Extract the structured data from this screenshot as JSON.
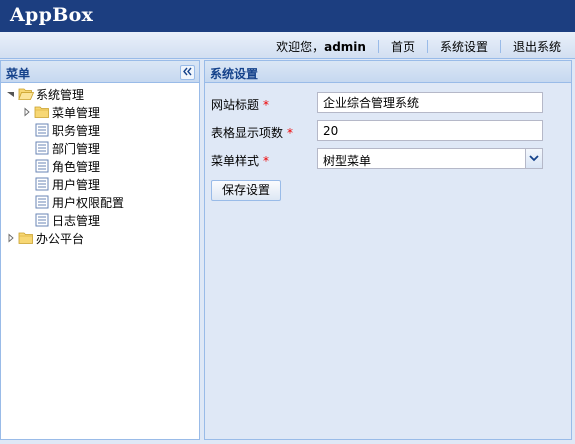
{
  "app": {
    "title": "AppBox"
  },
  "topbar": {
    "welcome": "欢迎您，",
    "username": "admin",
    "links": [
      "首页",
      "系统设置",
      "退出系统"
    ]
  },
  "menu": {
    "title": "菜单",
    "collapse_icon": "double-chevron-left-icon",
    "tree": [
      {
        "label": "系统管理",
        "type": "folder",
        "expanded": true,
        "level": 0
      },
      {
        "label": "菜单管理",
        "type": "folder",
        "expanded": false,
        "level": 1
      },
      {
        "label": "职务管理",
        "type": "leaf",
        "level": 1
      },
      {
        "label": "部门管理",
        "type": "leaf",
        "level": 1
      },
      {
        "label": "角色管理",
        "type": "leaf",
        "level": 1
      },
      {
        "label": "用户管理",
        "type": "leaf",
        "level": 1
      },
      {
        "label": "用户权限配置",
        "type": "leaf",
        "level": 1
      },
      {
        "label": "日志管理",
        "type": "leaf",
        "level": 1
      },
      {
        "label": "办公平台",
        "type": "folder",
        "expanded": false,
        "level": 0
      }
    ]
  },
  "settings": {
    "title": "系统设置",
    "fields": [
      {
        "label": "网站标题",
        "required_mark": "*",
        "value": "企业综合管理系统"
      },
      {
        "label": "表格显示项数",
        "required_mark": "*",
        "value": "20"
      },
      {
        "label": "菜单样式",
        "required_mark": "*",
        "value": "树型菜单"
      }
    ],
    "save_button": "保存设置"
  },
  "colors": {
    "header": "#1c3e80",
    "panel_title": "#15428b",
    "border": "#99bbe8",
    "required": "#e00000"
  }
}
